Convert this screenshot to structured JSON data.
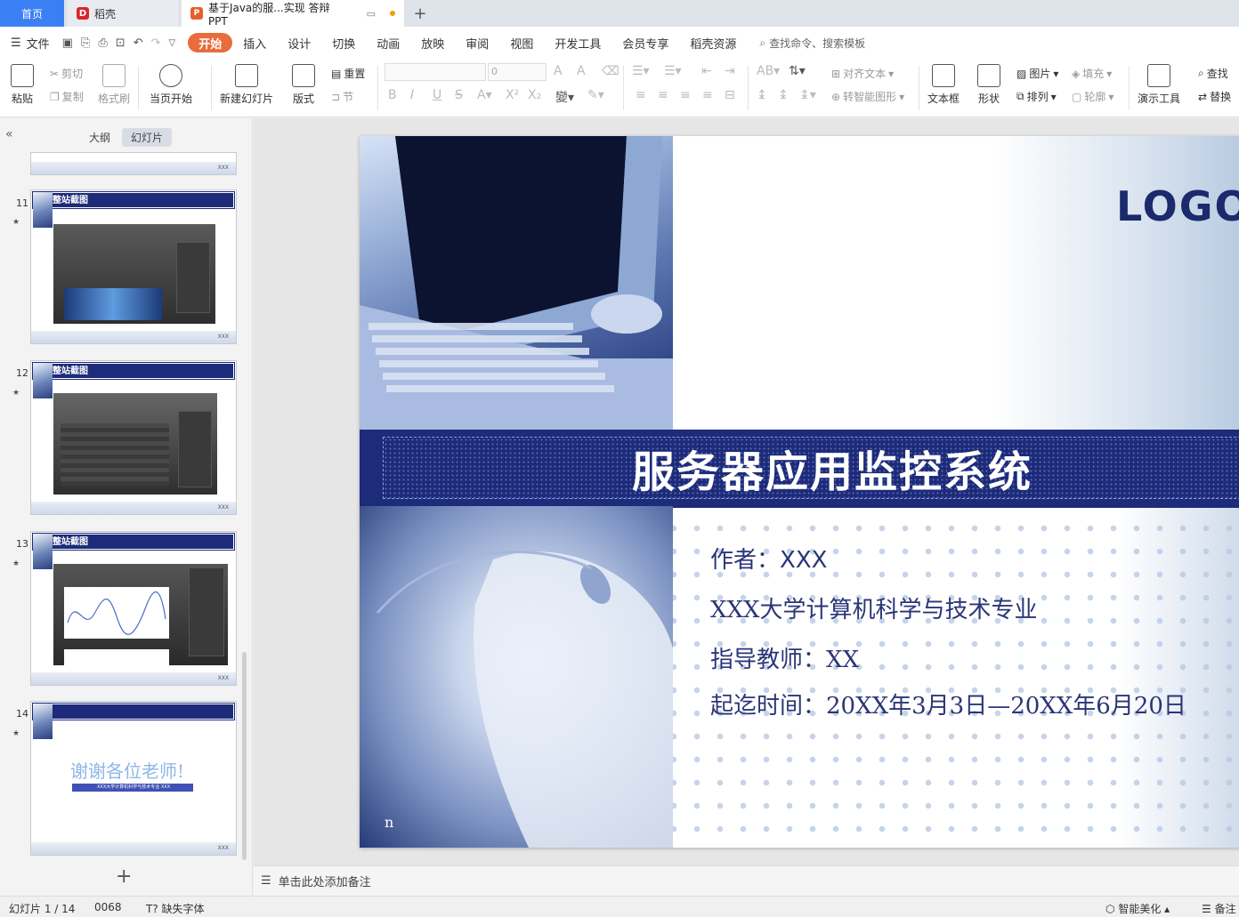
{
  "tabs": {
    "home": "首页",
    "docer": "稻壳",
    "document": "基于Java的服...实现 答辩PPT"
  },
  "menu": {
    "file": "文件",
    "items": [
      "开始",
      "插入",
      "设计",
      "切换",
      "动画",
      "放映",
      "审阅",
      "视图",
      "开发工具",
      "会员专享",
      "稻壳资源"
    ],
    "search": "查找命令、搜索模板"
  },
  "ribbon": {
    "paste": "粘贴",
    "cut": "剪切",
    "copy": "复制",
    "format_painter": "格式刷",
    "from_current": "当页开始",
    "new_slide": "新建幻灯片",
    "layout": "版式",
    "reset": "重置",
    "section": "节",
    "font_size": "0",
    "align_text": "对齐文本",
    "smart_art": "转智能图形",
    "text_box": "文本框",
    "shape": "形状",
    "picture": "图片",
    "arrange": "排列",
    "fill": "填充",
    "outline": "轮廓",
    "present_tools": "演示工具",
    "find": "查找",
    "replace": "替换"
  },
  "left_panel": {
    "tab_outline": "大纲",
    "tab_slides": "幻灯片",
    "thumbnails": [
      {
        "num": "11",
        "title": "整站截图"
      },
      {
        "num": "12",
        "title": "整站截图"
      },
      {
        "num": "13",
        "title": "整站截图"
      },
      {
        "num": "14",
        "title": "",
        "thanks": "谢谢各位老师!",
        "subline": "XXX大学计算机科学与技术专业    XXX"
      }
    ],
    "thumb_footer": "XXX"
  },
  "slide": {
    "logo": "LOGO",
    "title": "服务器应用监控系统",
    "author_label": "作者：",
    "author_value": "XXX",
    "major": "XXX大学计算机科学与技术专业",
    "advisor": "指导教师：XX",
    "period": "起迄时间：20XX年3月3日—20XX年6月20日",
    "corner_mark": "n"
  },
  "notes": {
    "placeholder": "单击此处添加备注"
  },
  "status": {
    "slide_counter": "幻灯片 1 / 14",
    "code": "0068",
    "missing_fonts": "缺失字体",
    "smart_beautify": "智能美化",
    "notes_toggle": "备注"
  },
  "colors": {
    "accent_orange": "#e86c3c",
    "tab_blue": "#3b7ff4",
    "slide_navy": "#1d2b7a",
    "text_navy": "#2b3577"
  }
}
